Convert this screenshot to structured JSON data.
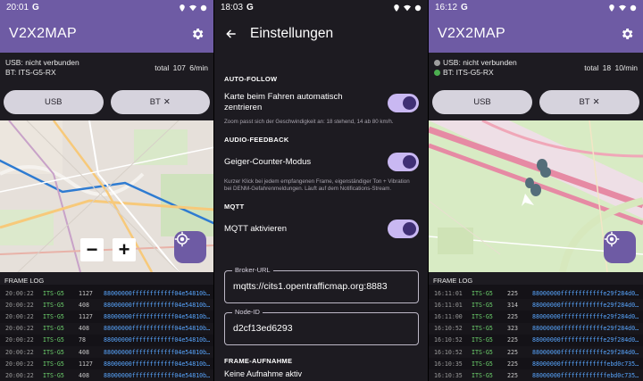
{
  "panel_left": {
    "status_time": "20:01",
    "status_g": "G",
    "app_title": "V2X2MAP",
    "usb_status": "USB: nicht verbunden",
    "bt_status": "BT: ITS-G5-RX",
    "counts": "total 107   6/min",
    "usb_button": "USB",
    "bt_button": "BT",
    "bt_icon": "✕",
    "zoom_out": "−",
    "zoom_in": "+",
    "log_title": "FRAME LOG",
    "log": [
      {
        "time": "20:00:22",
        "src": "ITS-G5",
        "len": "1127",
        "hex": "88000000ffffffffffff04e54810b…"
      },
      {
        "time": "20:00:22",
        "src": "ITS-G5",
        "len": "408",
        "hex": "88000000ffffffffffff04e54810b…"
      },
      {
        "time": "20:00:22",
        "src": "ITS-G5",
        "len": "1127",
        "hex": "88000000ffffffffffff04e54810b…"
      },
      {
        "time": "20:00:22",
        "src": "ITS-G5",
        "len": "408",
        "hex": "88000000ffffffffffff04e54810b…"
      },
      {
        "time": "20:00:22",
        "src": "ITS-G5",
        "len": "78",
        "hex": "88000000ffffffffffff04e54810b…"
      },
      {
        "time": "20:00:22",
        "src": "ITS-G5",
        "len": "408",
        "hex": "88000000ffffffffffff04e54810b…"
      },
      {
        "time": "20:00:22",
        "src": "ITS-G5",
        "len": "1127",
        "hex": "88000000ffffffffffff04e54810b…"
      },
      {
        "time": "20:00:22",
        "src": "ITS-G5",
        "len": "408",
        "hex": "88000000ffffffffffff04e54810b…"
      },
      {
        "time": "20:00:22",
        "src": "ITS-G5",
        "len": "323",
        "hex": "88000000ffffffffffff726288b33…"
      }
    ]
  },
  "panel_middle": {
    "status_time": "18:03",
    "status_g": "G",
    "title": "Einstellungen",
    "auto_follow_header": "AUTO-FOLLOW",
    "auto_follow_label": "Karte beim Fahren automatisch zentrieren",
    "auto_follow_help": "Zoom passt sich der Geschwindigkeit an: 18 stehend, 14 ab 80 km/h.",
    "audio_header": "AUDIO-FEEDBACK",
    "geiger_label": "Geiger-Counter-Modus",
    "geiger_help": "Kurzer Klick bei jedem empfangenen Frame, eigenständiger Ton + Vibration bei DENM-Gefahrenmeldungen. Läuft auf dem Notifications-Stream.",
    "mqtt_header": "MQTT",
    "mqtt_label": "MQTT aktivieren",
    "broker_label": "Broker-URL",
    "broker_value": "mqtts://cits1.opentrafficmap.org:8883",
    "node_label": "Node-ID",
    "node_value": "d2cf13ed6293",
    "recording_header": "FRAME-AUFNAHME",
    "recording_status": "Keine Aufnahme aktiv"
  },
  "panel_right": {
    "status_time": "16:12",
    "status_g": "G",
    "app_title": "V2X2MAP",
    "usb_status": "USB: nicht verbunden",
    "bt_status": "BT: ITS-G5-RX",
    "counts": "total 18   10/min",
    "usb_button": "USB",
    "bt_button": "BT",
    "bt_icon": "✕",
    "log_title": "FRAME LOG",
    "log": [
      {
        "time": "16:11:01",
        "src": "ITS-G5",
        "len": "225",
        "hex": "88000000ffffffffffffe29f284d0…"
      },
      {
        "time": "16:11:01",
        "src": "ITS-G5",
        "len": "314",
        "hex": "88000000ffffffffffffe29f284d0…"
      },
      {
        "time": "16:11:00",
        "src": "ITS-G5",
        "len": "225",
        "hex": "88000000ffffffffffffe29f284d0…"
      },
      {
        "time": "16:10:52",
        "src": "ITS-G5",
        "len": "323",
        "hex": "88000000ffffffffffffe29f284d0…"
      },
      {
        "time": "16:10:52",
        "src": "ITS-G5",
        "len": "225",
        "hex": "88000000ffffffffffffe29f284d0…"
      },
      {
        "time": "16:10:52",
        "src": "ITS-G5",
        "len": "225",
        "hex": "88000000ffffffffffffe29f284d0…"
      },
      {
        "time": "16:10:35",
        "src": "ITS-G5",
        "len": "225",
        "hex": "88000000fffffffffffffebd0c735…"
      },
      {
        "time": "16:10:35",
        "src": "ITS-G5",
        "len": "225",
        "hex": "88000000fffffffffffffebd0c735…"
      },
      {
        "time": "16:10:35",
        "src": "ITS-G5",
        "len": "367",
        "hex": "88000000fffffffffffffebd0c735…"
      }
    ]
  },
  "colors": {
    "accent": "#6e5ba4",
    "dark_bg": "#1d1b21",
    "usb_dot": "#9e9e9e",
    "bt_dot": "#4caf50",
    "log_green": "#6dd26d",
    "log_blue": "#58a6ff",
    "toggle_track": "#c9b8f2",
    "toggle_knob": "#3f2f74"
  },
  "icons": [
    "gear-icon",
    "back-arrow-icon",
    "locate-icon",
    "close-icon",
    "wifi-icon",
    "battery-icon",
    "location-pin-icon"
  ]
}
